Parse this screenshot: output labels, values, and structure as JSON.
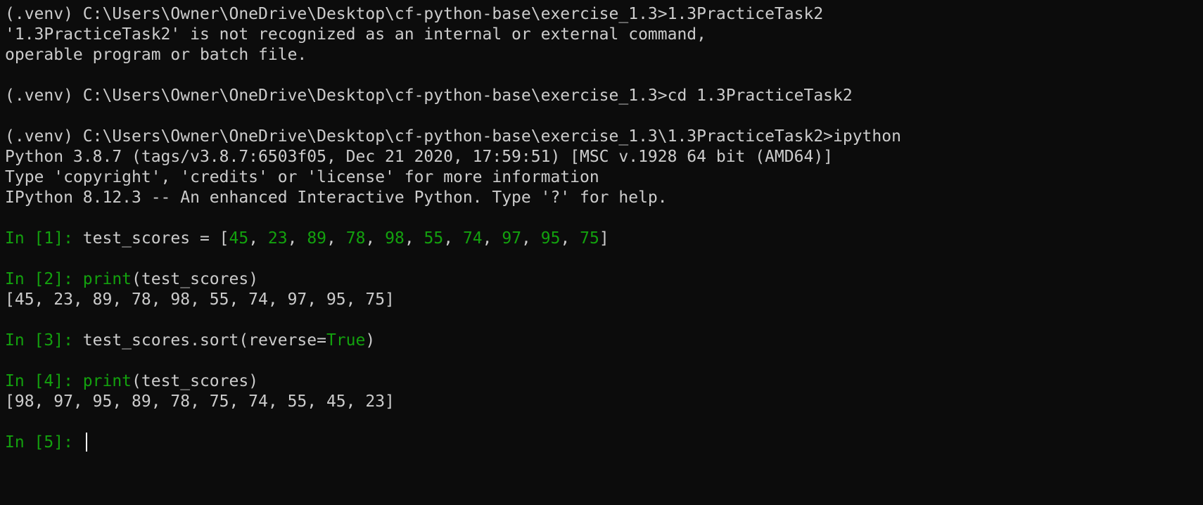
{
  "terminal": {
    "colors": {
      "background": "#0c0c0c",
      "foreground": "#cccccc",
      "prompt_green": "#13a10e",
      "cursor": "#ffffff"
    },
    "lines": [
      "(.venv) C:\\Users\\Owner\\OneDrive\\Desktop\\cf-python-base\\exercise_1.3>1.3PracticeTask2",
      "'1.3PracticeTask2' is not recognized as an internal or external command,",
      "operable program or batch file.",
      "(.venv) C:\\Users\\Owner\\OneDrive\\Desktop\\cf-python-base\\exercise_1.3>cd 1.3PracticeTask2",
      "(.venv) C:\\Users\\Owner\\OneDrive\\Desktop\\cf-python-base\\exercise_1.3\\1.3PracticeTask2>ipython",
      "Python 3.8.7 (tags/v3.8.7:6503f05, Dec 21 2020, 17:59:51) [MSC v.1928 64 bit (AMD64)]",
      "Type 'copyright', 'credits' or 'license' for more information",
      "IPython 8.12.3 -- An enhanced Interactive Python. Type '?' for help."
    ],
    "in1": {
      "prompt": "In [1]: ",
      "code_pre": "test_scores = [",
      "values": [
        "45",
        "23",
        "89",
        "78",
        "98",
        "55",
        "74",
        "97",
        "95",
        "75"
      ],
      "sep": ", ",
      "code_post": "]"
    },
    "in2": {
      "prompt": "In [2]: ",
      "func": "print",
      "args": "(test_scores)",
      "output": "[45, 23, 89, 78, 98, 55, 74, 97, 95, 75]"
    },
    "in3": {
      "prompt": "In [3]: ",
      "code_pre": "test_scores.sort(reverse=",
      "keyword": "True",
      "code_post": ")"
    },
    "in4": {
      "prompt": "In [4]: ",
      "func": "print",
      "args": "(test_scores)",
      "output": "[98, 97, 95, 89, 78, 75, 74, 55, 45, 23]"
    },
    "in5": {
      "prompt": "In [5]: "
    }
  }
}
